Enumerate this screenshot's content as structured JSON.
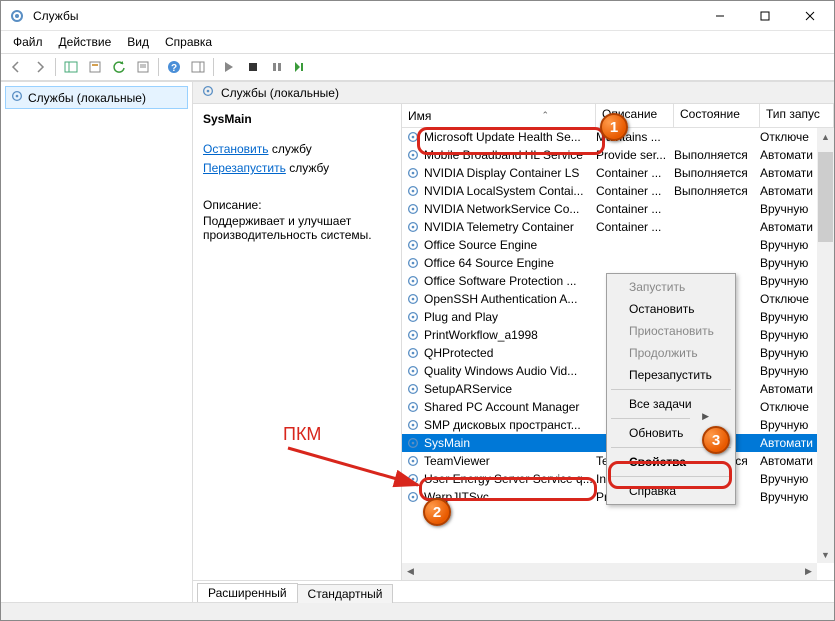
{
  "window": {
    "title": "Службы"
  },
  "menubar": {
    "file": "Файл",
    "action": "Действие",
    "view": "Вид",
    "help": "Справка"
  },
  "nav": {
    "item": "Службы (локальные)"
  },
  "panel_header": "Службы (локальные)",
  "detail": {
    "service_name": "SysMain",
    "stop_link": "Остановить",
    "stop_suffix": " службу",
    "restart_link": "Перезапустить",
    "restart_suffix": " службу",
    "desc_label": "Описание:",
    "desc_text": "Поддерживает и улучшает производительность системы."
  },
  "columns": {
    "name": "Имя",
    "desc": "Описание",
    "state": "Состояние",
    "start": "Тип запус"
  },
  "rows": [
    {
      "name": "Microsoft Update Health Se...",
      "desc": "Maintains ...",
      "state": "",
      "start": "Отключе"
    },
    {
      "name": "Mobile Broadband HL Service",
      "desc": "Provide ser...",
      "state": "Выполняется",
      "start": "Автомати"
    },
    {
      "name": "NVIDIA Display Container LS",
      "desc": "Container ...",
      "state": "Выполняется",
      "start": "Автомати"
    },
    {
      "name": "NVIDIA LocalSystem Contai...",
      "desc": "Container ...",
      "state": "Выполняется",
      "start": "Автомати"
    },
    {
      "name": "NVIDIA NetworkService Co...",
      "desc": "Container ...",
      "state": "",
      "start": "Вручную"
    },
    {
      "name": "NVIDIA Telemetry Container",
      "desc": "Container ...",
      "state": "",
      "start": "Автомати"
    },
    {
      "name": "Office  Source Engine",
      "desc": "",
      "state": "",
      "start": "Вручную"
    },
    {
      "name": "Office 64 Source Engine",
      "desc": "",
      "state": "",
      "start": "Вручную"
    },
    {
      "name": "Office Software Protection ...",
      "desc": "",
      "state": "",
      "start": "Вручную"
    },
    {
      "name": "OpenSSH Authentication A...",
      "desc": "",
      "state": "",
      "start": "Отключе"
    },
    {
      "name": "Plug and Play",
      "desc": "",
      "state": "",
      "start": "Вручную"
    },
    {
      "name": "PrintWorkflow_a1998",
      "desc": "",
      "state": "",
      "start": "Вручную"
    },
    {
      "name": "QHProtected",
      "desc": "",
      "state": "",
      "start": "Вручную"
    },
    {
      "name": "Quality Windows Audio Vid...",
      "desc": "",
      "state": "",
      "start": "Вручную"
    },
    {
      "name": "SetupARService",
      "desc": "",
      "state": "",
      "start": "Автомати"
    },
    {
      "name": "Shared PC Account Manager",
      "desc": "",
      "state": "",
      "start": "Отключе"
    },
    {
      "name": "SMP дисковых пространст...",
      "desc": "",
      "state": "",
      "start": "Вручную"
    },
    {
      "name": "SysMain",
      "desc": "",
      "state": "",
      "start": "Автомати",
      "selected": true
    },
    {
      "name": "TeamViewer",
      "desc": "TeamView...",
      "state": "Выполняется",
      "start": "Автомати"
    },
    {
      "name": "User Energy Server Service q...",
      "desc": "Intel(r) Ene...",
      "state": "",
      "start": "Вручную"
    },
    {
      "name": "WarpJITSvc",
      "desc": "Provides a ...",
      "state": "",
      "start": "Вручную"
    }
  ],
  "tabs": {
    "extended": "Расширенный",
    "standard": "Стандартный"
  },
  "context_menu": {
    "start": "Запустить",
    "stop": "Остановить",
    "pause": "Приостановить",
    "resume": "Продолжить",
    "restart": "Перезапустить",
    "all_tasks": "Все задачи",
    "refresh": "Обновить",
    "properties": "Свойства",
    "help": "Справка"
  },
  "annotations": {
    "rmb_label": "ПКМ"
  }
}
